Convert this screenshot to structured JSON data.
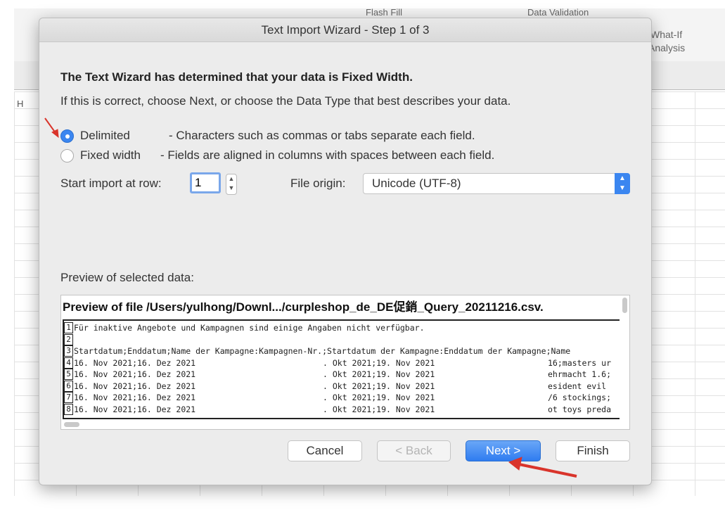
{
  "background": {
    "column_header": "H",
    "ribbon_flash_fill": "Flash Fill",
    "ribbon_data_validation": "Data Validation",
    "what_if_line1": "What-If",
    "what_if_line2": "Analysis"
  },
  "dialog": {
    "title": "Text Import Wizard - Step 1 of 3",
    "heading": "The Text Wizard has determined that your data is Fixed Width.",
    "subtext": "If this is correct, choose Next, or choose the Data Type that best describes your data.",
    "data_type_options": [
      {
        "label": "Delimited",
        "description": "- Characters such as commas or tabs separate each field.",
        "selected": true
      },
      {
        "label": "Fixed width",
        "description": "- Fields are aligned in columns with spaces between each field.",
        "selected": false
      }
    ],
    "start_row_label": "Start import at row:",
    "start_row_value": "1",
    "file_origin_label": "File origin:",
    "file_origin_value": "Unicode (UTF-8)",
    "preview_label": "Preview of selected data:",
    "preview_title": "Preview of file /Users/yulhong/Downl.../curpleshop_de_DE促銷_Query_20211216.csv.",
    "preview_rows": [
      {
        "n": "1",
        "a": "Für inaktive Angebote und Kampagnen sind einige Angaben nicht verfügbar.",
        "b": "",
        "c": ""
      },
      {
        "n": "2",
        "a": "",
        "b": "",
        "c": ""
      },
      {
        "n": "3",
        "a": "Startdatum;Enddatum;Name der Kampagne:Kampagnen-Nr.;Startdatum der Kampagne:Enddatum der Kampagne;Name",
        "b": "",
        "c": ""
      },
      {
        "n": "4",
        "a": "16. Nov 2021;16. Dez 2021",
        "b": ". Okt 2021;19. Nov 2021",
        "c": "16;masters ur"
      },
      {
        "n": "5",
        "a": "16. Nov 2021;16. Dez 2021",
        "b": ". Okt 2021;19. Nov 2021",
        "c": "ehrmacht 1.6;"
      },
      {
        "n": "6",
        "a": "16. Nov 2021;16. Dez 2021",
        "b": ". Okt 2021;19. Nov 2021",
        "c": "esident evil"
      },
      {
        "n": "7",
        "a": "16. Nov 2021;16. Dez 2021",
        "b": ". Okt 2021;19. Nov 2021",
        "c": "/6 stockings;"
      },
      {
        "n": "8",
        "a": "16. Nov 2021;16. Dez 2021",
        "b": ". Okt 2021;19. Nov 2021",
        "c": "ot toys preda"
      }
    ],
    "buttons": {
      "cancel": "Cancel",
      "back": "< Back",
      "next": "Next >",
      "finish": "Finish"
    },
    "accent_color": "#3b86f0",
    "annotation_arrow_color": "#d9342b"
  }
}
